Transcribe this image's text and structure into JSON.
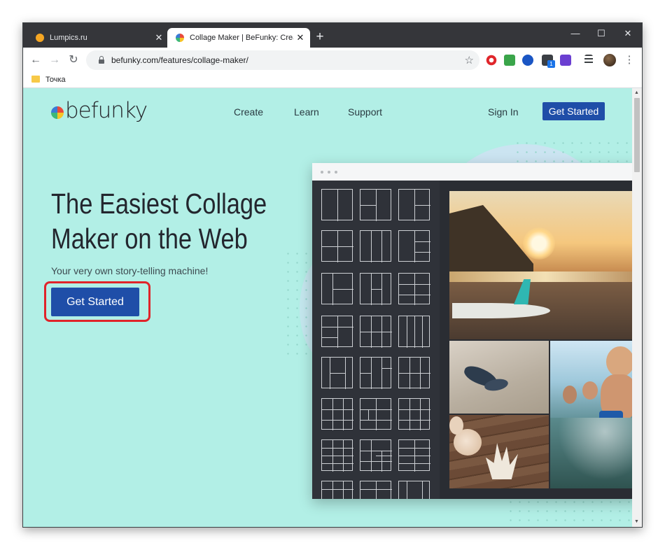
{
  "browser": {
    "tabs": [
      {
        "title": "Lumpics.ru",
        "close": "✕"
      },
      {
        "title": "Collage Maker | BeFunky: Create",
        "close": "✕"
      }
    ],
    "new_tab": "+",
    "window_controls": {
      "minimize": "—",
      "maximize": "☐",
      "close": "✕"
    },
    "nav": {
      "back": "←",
      "forward": "→",
      "reload": "↻"
    },
    "url": "befunky.com/features/collage-maker/",
    "star": "☆",
    "menu": "⋮",
    "bookmark": "Точка",
    "extension_badge": "1"
  },
  "site": {
    "logo": "befunky",
    "nav": [
      "Create",
      "Learn",
      "Support"
    ],
    "sign_in": "Sign In",
    "header_cta": "Get Started",
    "headline_line1": "The Easiest Collage",
    "headline_line2": "Maker on the Web",
    "subheadline": "Your very own story-telling machine!",
    "hero_cta": "Get Started"
  },
  "colors": {
    "page_bg": "#b2efe6",
    "brand_blue": "#1f4ea8",
    "highlight_red": "#e0242a",
    "tabstrip": "#35363a"
  },
  "icons": [
    "lock-icon",
    "star-icon",
    "opera-icon",
    "music-icon",
    "globe-icon",
    "extension-icon",
    "avatar",
    "menu-icon",
    "folder-icon"
  ]
}
